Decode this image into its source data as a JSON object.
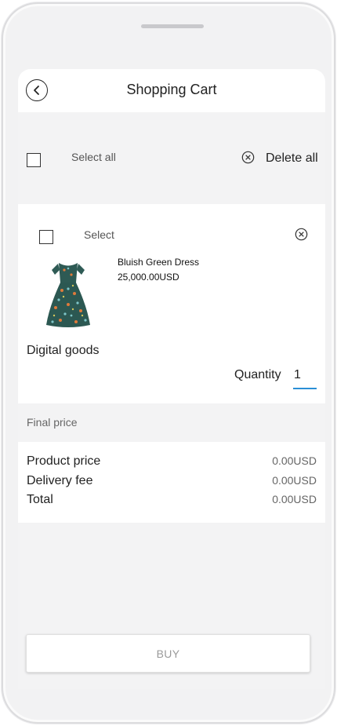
{
  "header": {
    "title": "Shopping Cart",
    "back_icon": "chevron-left-icon"
  },
  "select_bar": {
    "select_all_label": "Select all",
    "delete_all_label": "Delete all",
    "delete_icon": "close-circle-icon"
  },
  "cart_item": {
    "select_label": "Select",
    "product_name": "Bluish Green Dress",
    "product_price": "25,000.00USD",
    "category": "Digital goods",
    "quantity_label": "Quantity",
    "quantity_value": "1",
    "remove_icon": "close-circle-icon",
    "product_image": "dress-image"
  },
  "final_price": {
    "label": "Final price",
    "rows": [
      {
        "label": "Product price",
        "value": "0.00USD"
      },
      {
        "label": "Delivery fee",
        "value": "0.00USD"
      },
      {
        "label": "Total",
        "value": "0.00USD"
      }
    ]
  },
  "buy_button": {
    "label": "BUY"
  },
  "colors": {
    "accent": "#2a8fd6",
    "background": "#f3f3f4",
    "card": "#ffffff"
  }
}
